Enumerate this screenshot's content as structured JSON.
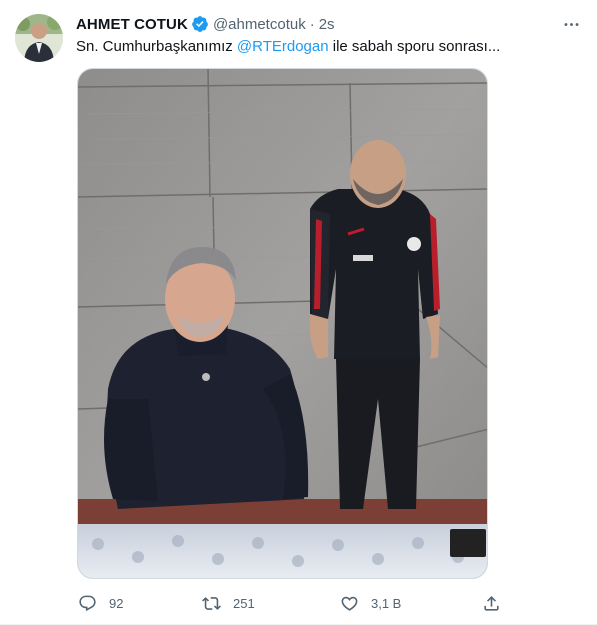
{
  "tweet": {
    "author_name": "AHMET COTUK",
    "handle": "@ahmetcotuk",
    "separator": "·",
    "time": "2s",
    "text_prefix": "Sn. Cumhurbaşkanımız ",
    "mention": "@RTErdogan",
    "text_suffix": " ile sabah sporu sonrası..."
  },
  "actions": {
    "reply_count": "92",
    "retweet_count": "251",
    "like_count": "3,1 B"
  },
  "colors": {
    "accent": "#1d9bf0",
    "secondary_text": "#536471",
    "verified": "#1d9bf0"
  },
  "icons": [
    "verified-badge-icon",
    "more-icon",
    "reply-icon",
    "retweet-icon",
    "like-icon",
    "share-icon"
  ]
}
